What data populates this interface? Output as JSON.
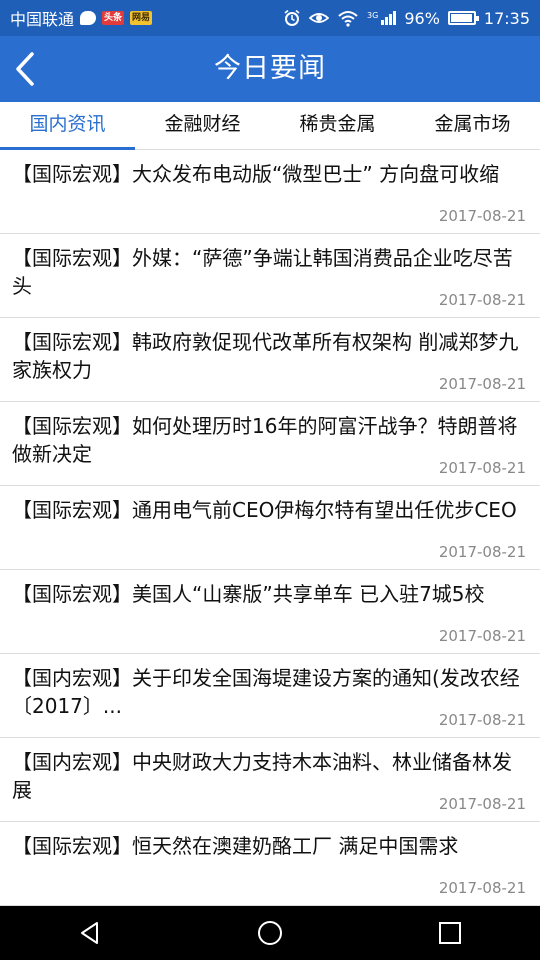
{
  "status_bar": {
    "carrier": "中国联通",
    "badge_1": "头条",
    "badge_2": "网易",
    "network": "3G",
    "battery": "96%",
    "battery_level": 0.96,
    "time": "17:35"
  },
  "header": {
    "title": "今日要闻"
  },
  "tabs": [
    {
      "label": "国内资讯",
      "active": true
    },
    {
      "label": "金融财经",
      "active": false
    },
    {
      "label": "稀贵金属",
      "active": false
    },
    {
      "label": "金属市场",
      "active": false
    }
  ],
  "news": [
    {
      "title": "【国际宏观】大众发布电动版“微型巴士” 方向盘可收缩",
      "date": "2017-08-21"
    },
    {
      "title": "【国际宏观】外媒：“萨德”争端让韩国消费品企业吃尽苦头",
      "date": "2017-08-21"
    },
    {
      "title": "【国际宏观】韩政府敦促现代改革所有权架构 削减郑梦九家族权力",
      "date": "2017-08-21"
    },
    {
      "title": "【国际宏观】如何处理历时16年的阿富汗战争？特朗普将做新决定",
      "date": "2017-08-21"
    },
    {
      "title": "【国际宏观】通用电气前CEO伊梅尔特有望出任优步CEO",
      "date": "2017-08-21"
    },
    {
      "title": "【国际宏观】美国人“山寨版”共享单车 已入驻7城5校",
      "date": "2017-08-21"
    },
    {
      "title": "【国内宏观】关于印发全国海堤建设方案的通知(发改农经〔2017〕...",
      "date": "2017-08-21"
    },
    {
      "title": "【国内宏观】中央财政大力支持木本油料、林业储备林发展",
      "date": "2017-08-21"
    },
    {
      "title": "【国际宏观】恒天然在澳建奶酪工厂 满足中国需求",
      "date": "2017-08-21"
    }
  ],
  "colors": {
    "accent": "#2a6fd0",
    "status_bar": "#1f5fb8"
  }
}
